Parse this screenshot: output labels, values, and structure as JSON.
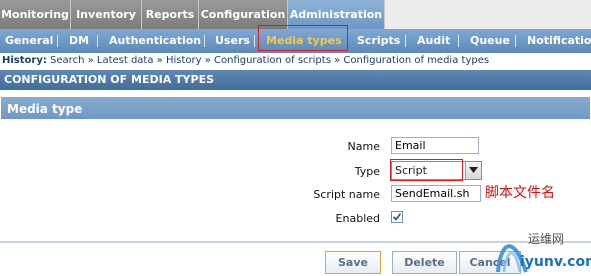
{
  "top_menu": [
    "Monitoring",
    "Inventory",
    "Reports",
    "Configuration",
    "Administration"
  ],
  "sub_menu": [
    "General",
    "DM",
    "Authentication",
    "Users",
    "Media types",
    "Scripts",
    "Audit",
    "Queue",
    "Notifications"
  ],
  "history": {
    "label": "History:",
    "trail": "Search » Latest data » History » Configuration of scripts » Configuration of media types"
  },
  "page_header": "CONFIGURATION OF MEDIA TYPES",
  "form": {
    "title": "Media type",
    "name_label": "Name",
    "name_value": "Email",
    "type_label": "Type",
    "type_value": "Script",
    "script_label": "Script name",
    "script_value": "SendEmail.sh",
    "enabled_label": "Enabled",
    "enabled_checked": true
  },
  "annotation": "脚本文件名",
  "buttons": {
    "save": "Save",
    "delete": "Delete",
    "cancel": "Cancel"
  },
  "watermark": {
    "site_cn": "运维网",
    "site": "iyunv.com"
  }
}
